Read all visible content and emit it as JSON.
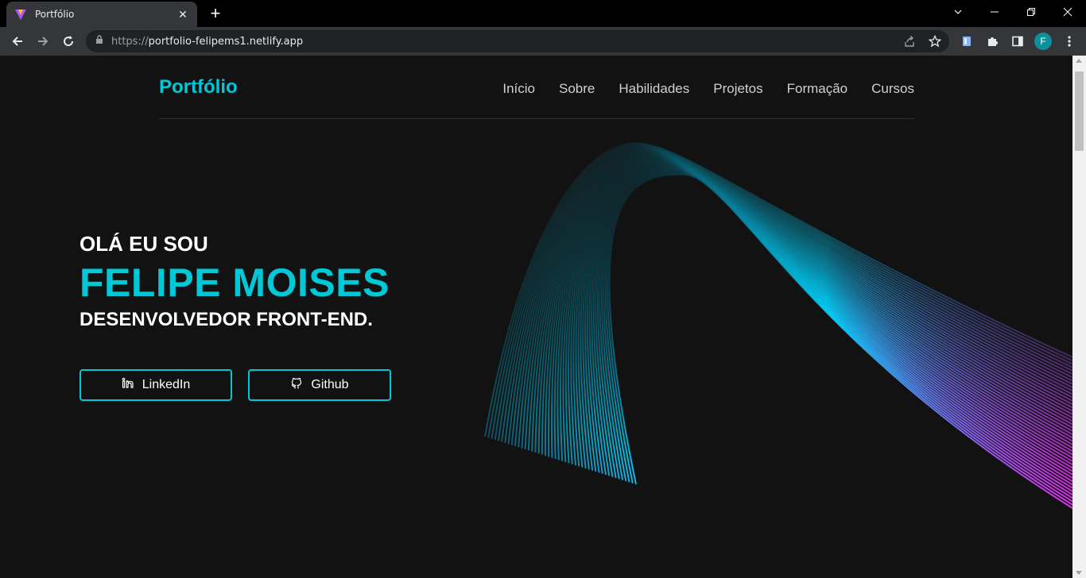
{
  "browser": {
    "tab_title": "Portfólio",
    "tab_close": "✕",
    "new_tab": "+",
    "url_scheme": "https://",
    "url_host": "portfolio-felipems1.netlify.app",
    "profile_initial": "F"
  },
  "site": {
    "logo": "Portfólio",
    "nav": [
      "Início",
      "Sobre",
      "Habilidades",
      "Projetos",
      "Formação",
      "Cursos"
    ],
    "hero": {
      "greeting": "OLÁ EU SOU",
      "name": "FELIPE MOISES",
      "role": "DESENVOLVEDOR FRONT-END."
    },
    "buttons": {
      "linkedin": "LinkedIn",
      "github": "Github"
    }
  },
  "colors": {
    "accent": "#00c8d7",
    "background": "#121212",
    "wave_start": "#00d4ff",
    "wave_end": "#e030f0"
  }
}
